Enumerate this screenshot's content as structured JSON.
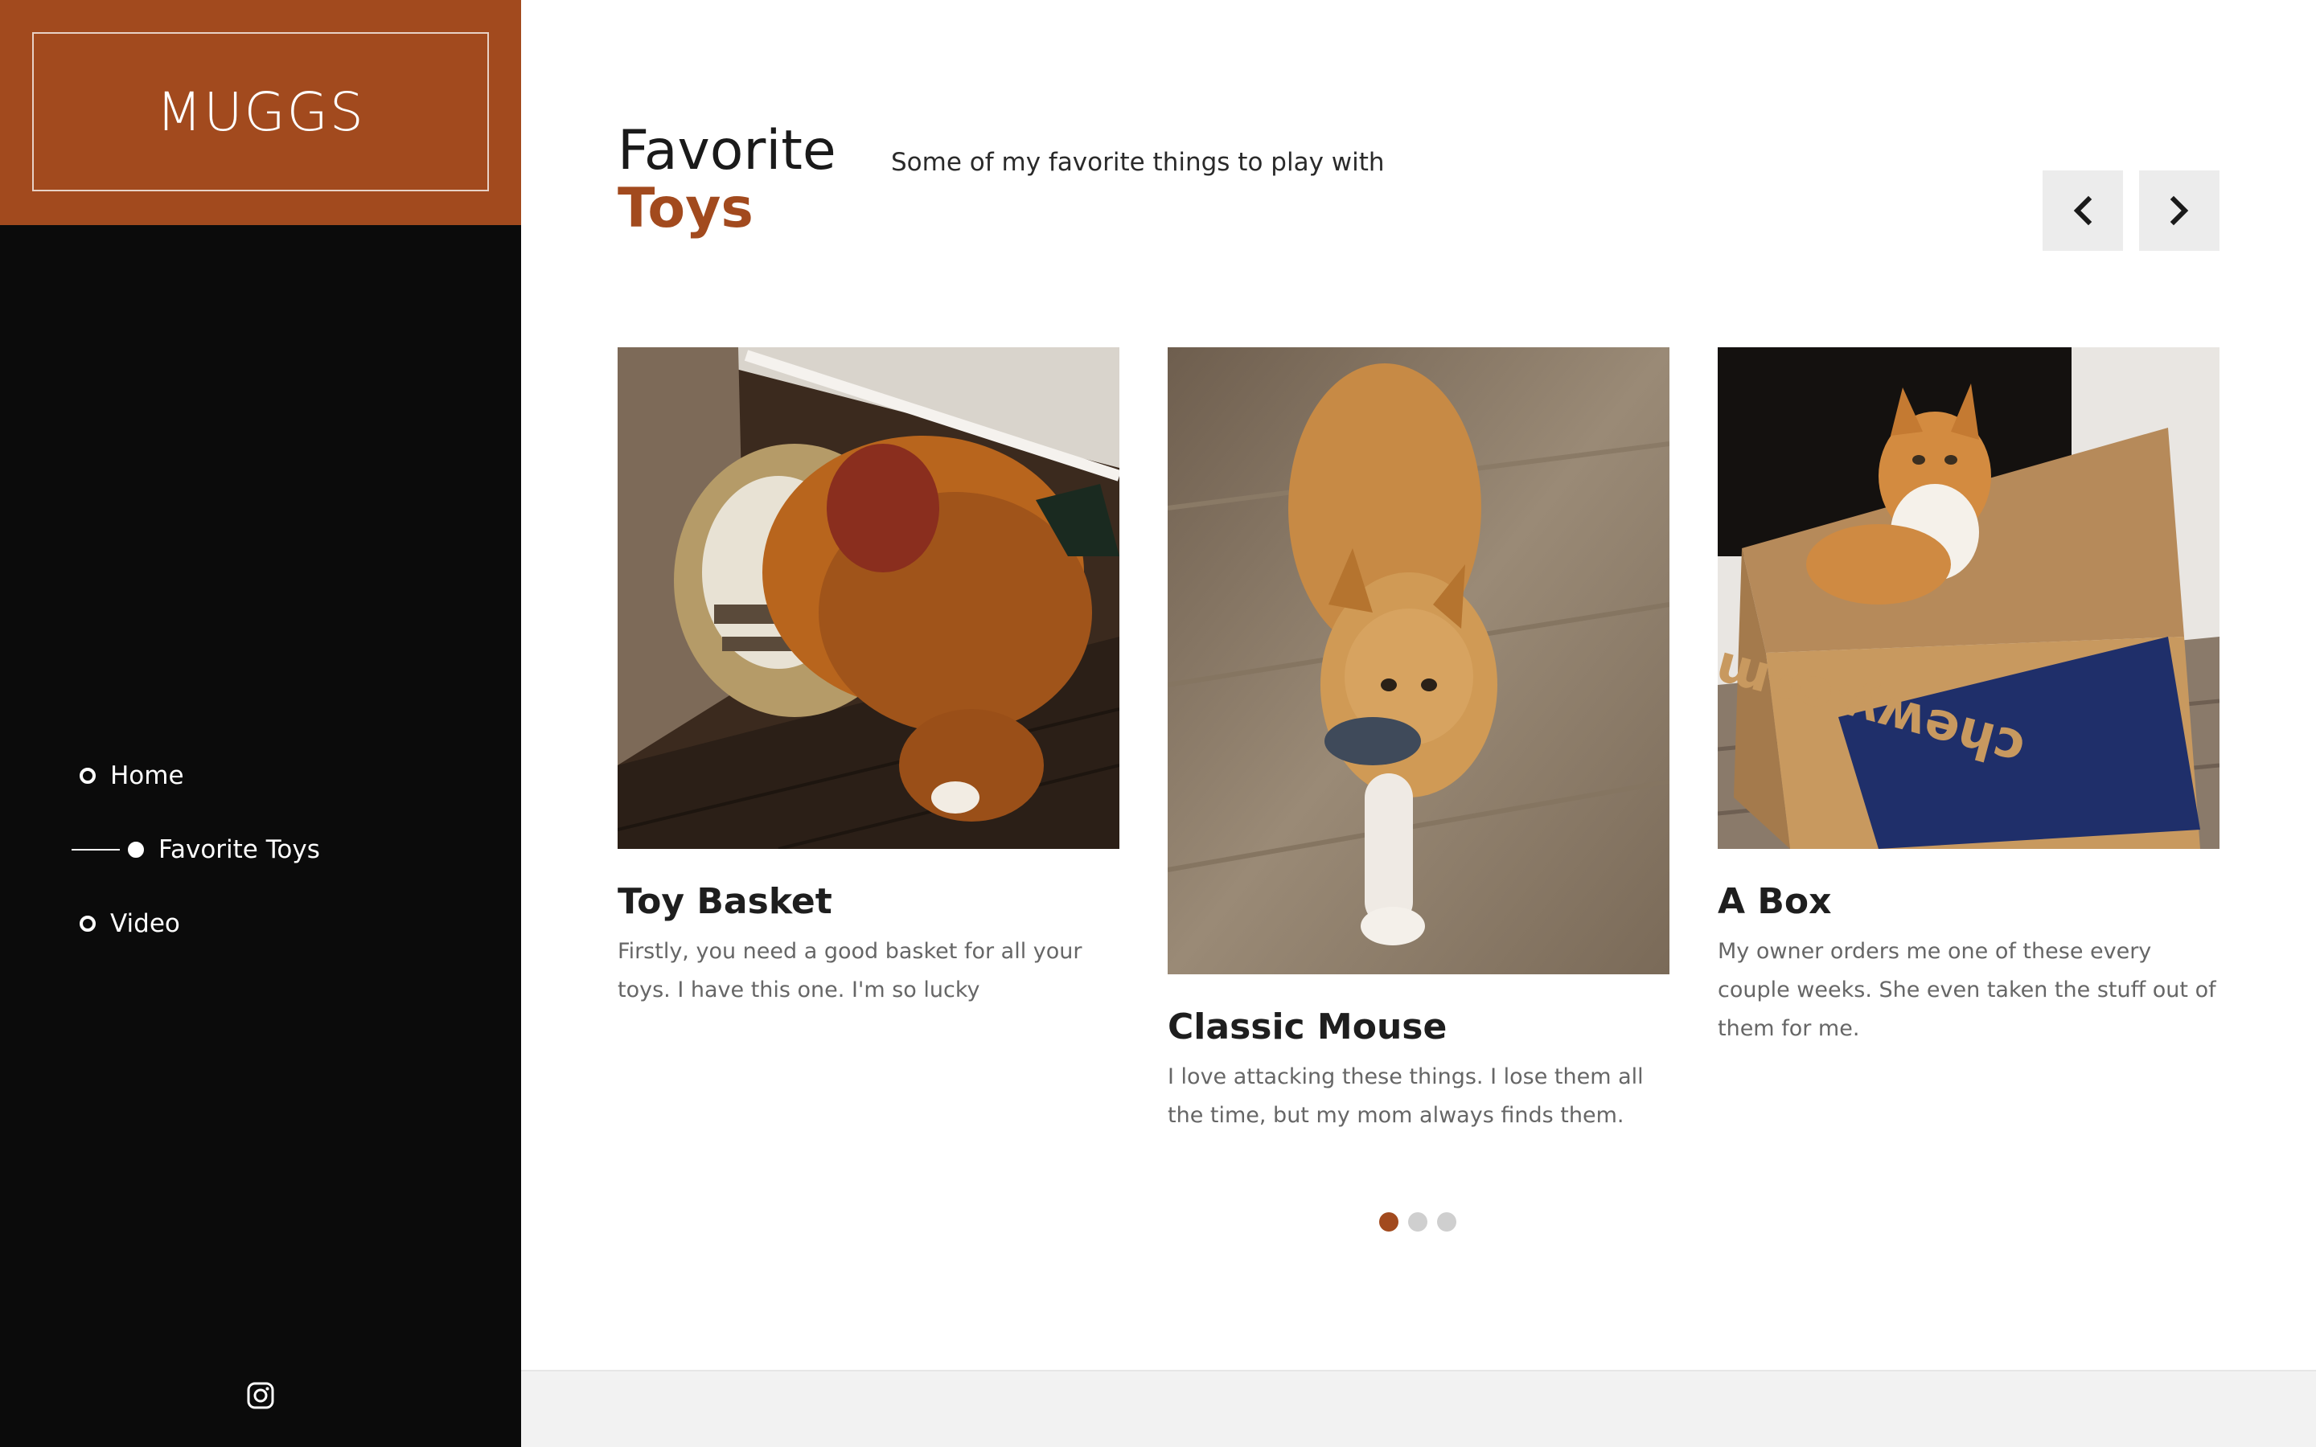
{
  "brand": {
    "name": "MUGGS",
    "color": "#a24a1e"
  },
  "nav": {
    "items": [
      {
        "label": "Home",
        "active": false
      },
      {
        "label": "Favorite Toys",
        "active": true
      },
      {
        "label": "Video",
        "active": false
      }
    ]
  },
  "social": {
    "icon": "instagram-icon"
  },
  "section": {
    "title_line1": "Favorite",
    "title_line2": "Toys",
    "subtitle": "Some of my favorite things to play with"
  },
  "carousel": {
    "prev_icon": "chevron-left-icon",
    "next_icon": "chevron-right-icon",
    "cards": [
      {
        "title": "Toy Basket",
        "description": "Firstly, you need a good basket for all your toys. I have this one. I'm so lucky",
        "image_subject": "orange cat with head in a woven toy basket"
      },
      {
        "title": "Classic Mouse",
        "description": "I love attacking these things. I lose them all the time, but my mom always finds them.",
        "image_subject": "orange cat carrying a toy mouse"
      },
      {
        "title": "A Box",
        "description": "My owner orders me one of these every couple weeks. She even taken the stuff out of them for me.",
        "image_subject": "orange cat sitting in a cardboard box",
        "box_print": "chewy.com"
      }
    ],
    "pagination": {
      "total": 3,
      "active": 1
    }
  },
  "colors": {
    "accent": "#a24a1e",
    "sidebar_bg": "#0b0b0b",
    "arrow_bg": "#ececec",
    "footer_bg": "#f2f2f2"
  }
}
